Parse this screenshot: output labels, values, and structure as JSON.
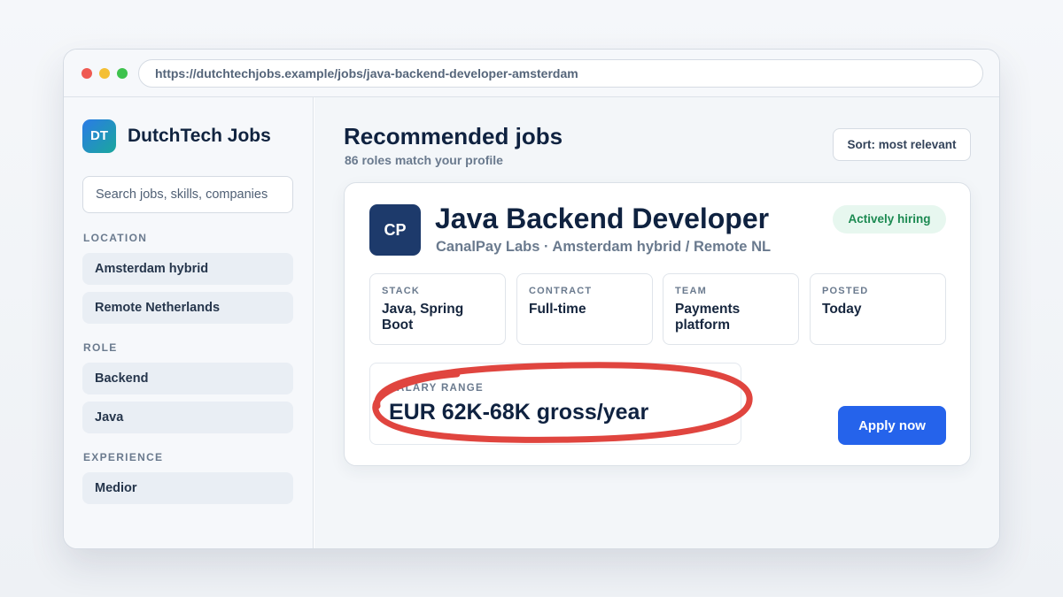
{
  "browser": {
    "url": "https://dutchtechjobs.example/jobs/java-backend-developer-amsterdam"
  },
  "sidebar": {
    "logo_initials": "DT",
    "brand": "DutchTech Jobs",
    "search_placeholder": "Search jobs, skills, companies",
    "sections": [
      {
        "label": "LOCATION",
        "items": [
          "Amsterdam hybrid",
          "Remote Netherlands"
        ]
      },
      {
        "label": "ROLE",
        "items": [
          "Backend",
          "Java"
        ]
      },
      {
        "label": "EXPERIENCE",
        "items": [
          "Medior"
        ]
      }
    ]
  },
  "main": {
    "title": "Recommended jobs",
    "subtitle": "86 roles match your profile",
    "sort_label": "Sort: most relevant"
  },
  "job": {
    "company_initials": "CP",
    "title": "Java Backend Developer",
    "meta": "CanalPay Labs · Amsterdam hybrid / Remote NL",
    "status_badge": "Actively hiring",
    "stats": [
      {
        "label": "STACK",
        "value": "Java, Spring Boot"
      },
      {
        "label": "CONTRACT",
        "value": "Full-time"
      },
      {
        "label": "TEAM",
        "value": "Payments platform"
      },
      {
        "label": "POSTED",
        "value": "Today"
      }
    ],
    "salary_label": "SALARY RANGE",
    "salary_value": "EUR 62K-68K gross/year",
    "apply_label": "Apply now"
  },
  "colors": {
    "accent": "#2563eb",
    "company_logo": "#1d3a6b",
    "badge_bg": "#e7f7ef",
    "badge_text": "#1c8a52",
    "highlight_circle": "#e0453f"
  }
}
